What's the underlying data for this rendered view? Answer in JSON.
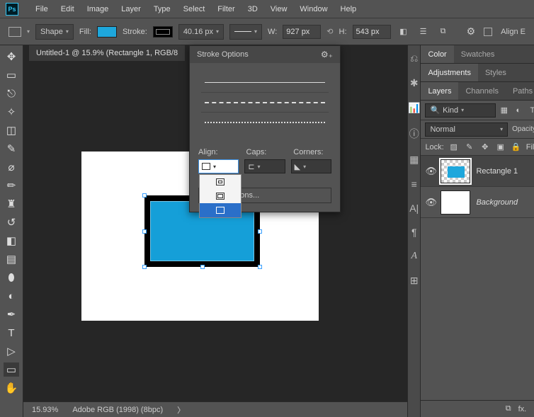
{
  "menu": [
    "File",
    "Edit",
    "Image",
    "Layer",
    "Type",
    "Select",
    "Filter",
    "3D",
    "View",
    "Window",
    "Help"
  ],
  "optbar": {
    "mode": "Shape",
    "fill_label": "Fill:",
    "stroke_label": "Stroke:",
    "stroke_width": "40.16 px",
    "w_label": "W:",
    "w_val": "927 px",
    "h_label": "H:",
    "h_val": "543 px",
    "align_edges": "Align E"
  },
  "doc_tab": "Untitled-1 @ 15.9% (Rectangle 1, RGB/8",
  "stroke_popup": {
    "title": "Stroke Options",
    "align": "Align:",
    "caps": "Caps:",
    "corners": "Corners:",
    "more": "More Options..."
  },
  "right": {
    "color_tab": "Color",
    "swatches_tab": "Swatches",
    "adjustments_tab": "Adjustments",
    "styles_tab": "Styles",
    "layers_tab": "Layers",
    "channels_tab": "Channels",
    "paths_tab": "Paths",
    "kind": "Kind",
    "blend": "Normal",
    "opacity": "Opacity:",
    "lock": "Lock:",
    "fill": "Fill:",
    "layer1": "Rectangle 1",
    "layer2": "Background"
  },
  "status": {
    "zoom": "15.93%",
    "profile": "Adobe RGB (1998) (8bpc)"
  }
}
